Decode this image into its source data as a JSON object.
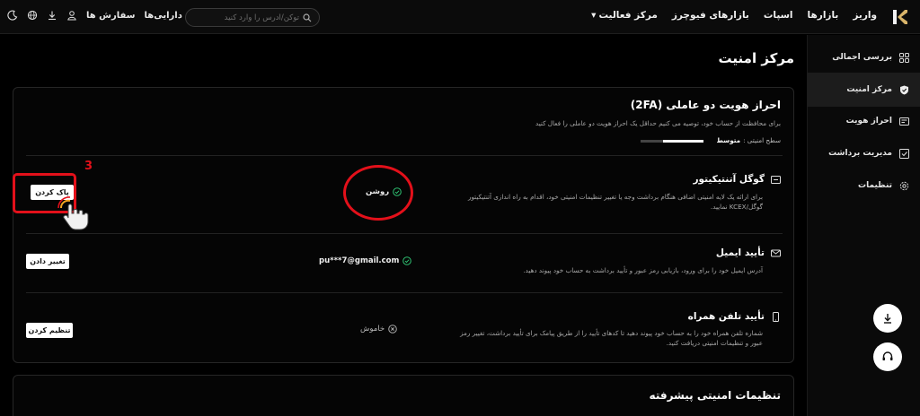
{
  "header": {
    "nav": [
      "واریز",
      "بازارها",
      "اسپات",
      "بازارهای فیوچرز",
      "مرکز فعالیت"
    ],
    "nav_dropdown_arrow": "▾",
    "search_placeholder": "توکن/آدرس را وارد کنید",
    "assets_label": "دارایی‌ها",
    "orders_label": "سفارش ها"
  },
  "sidebar": {
    "items": [
      {
        "label": "بررسی اجمالی",
        "icon": "grid-icon"
      },
      {
        "label": "مرکز امنیت",
        "icon": "shield-icon"
      },
      {
        "label": "احراز هویت",
        "icon": "id-card-icon"
      },
      {
        "label": "مدیریت برداشت",
        "icon": "withdraw-icon"
      },
      {
        "label": "تنظیمات",
        "icon": "gear-icon"
      }
    ],
    "active_index": 1
  },
  "page": {
    "title": "مرکز امنیت"
  },
  "twofa": {
    "title": "احراز هویت دو عاملی (2FA)",
    "description": "برای محافظت از حساب خود، توصیه می کنیم حداقل یک احراز هویت دو عاملی را فعال کنید",
    "level_label": "سطح امنیتی :",
    "level_value": "متوسط"
  },
  "rows": [
    {
      "title": "گوگل آتنتیکیتور",
      "description_line1": "برای ارائه یک لایه امنیتی اضافی هنگام برداشت وجه یا تغییر تنظیمات امنیتی خود، اقدام به راه اندازی آتنتیکیتور",
      "description_line2": "گوگل/KCEX نمایید.",
      "status": "روشن",
      "button": "پاک کردن"
    },
    {
      "title": "تأیید ایمیل",
      "description_line1": "آدرس ایمیل خود را برای ورود، بازیابی رمز عبور و تأیید برداشت به حساب خود پیوند دهید.",
      "status": "pu***7@gmail.com",
      "button": "تغییر دادن"
    },
    {
      "title": "تأیید تلفن همراه",
      "description_line1": "شماره تلفن همراه خود را به حساب خود پیوند دهید تا کدهای تأیید را از طریق پیامک برای تأیید برداشت، تغییر رمز",
      "description_line2": "عبور و تنظیمات امنیتی دریافت کنید.",
      "status": "خاموش",
      "button": "تنظیم کردن"
    }
  ],
  "advanced": {
    "title": "تنظیمات امنیتی پیشرفته"
  },
  "annotation": {
    "step_number": "3"
  },
  "colors": {
    "accent_green": "#2fbf71",
    "annotation_red": "#e3101a"
  }
}
